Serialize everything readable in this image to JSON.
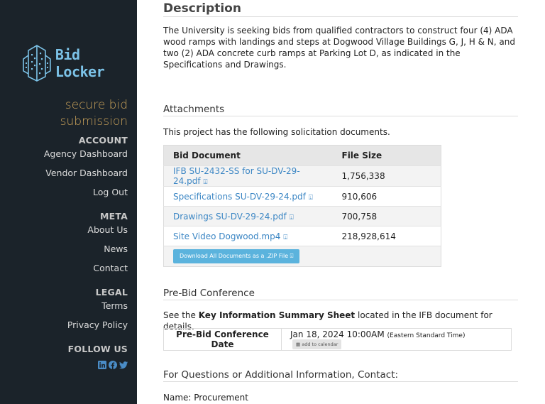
{
  "brand": {
    "name": "Bid Locker",
    "tagline_line1": "secure bid",
    "tagline_line2": "submission",
    "colors": {
      "sidebar_bg": "#1b232a",
      "logo": "#7cc3e8",
      "tagline": "#c9a25a",
      "link": "#3b86c4",
      "button": "#5bb3dd"
    }
  },
  "sidebar": {
    "account": {
      "heading": "ACCOUNT",
      "items": [
        "Agency Dashboard",
        "Vendor Dashboard",
        "Log Out"
      ]
    },
    "meta": {
      "heading": "META",
      "items": [
        "About Us",
        "News",
        "Contact"
      ]
    },
    "legal": {
      "heading": "LEGAL",
      "items": [
        "Terms",
        "Privacy Policy"
      ]
    },
    "follow": {
      "heading": "FOLLOW US",
      "icons": [
        "linkedin-icon",
        "facebook-icon",
        "twitter-icon"
      ]
    }
  },
  "description": {
    "title": "Description",
    "text": "The University is seeking bids from qualified contractors to construct four (4) ADA wood ramps with landings and steps at Dogwood Village Buildings G, J, H & N, and two (2) ADA concrete curb ramps at Parking Lot D, as indicated in the Specifications and Drawings."
  },
  "attachments": {
    "title": "Attachments",
    "intro": "This project has the following solicitation documents.",
    "columns": [
      "Bid Document",
      "File Size"
    ],
    "rows": [
      {
        "name": "IFB SU-2432-SS for SU-DV-29-24.pdf",
        "size": "1,756,338"
      },
      {
        "name": "Specifications SU-DV-29-24.pdf",
        "size": "910,606"
      },
      {
        "name": "Drawings SU-DV-29-24.pdf",
        "size": "700,758"
      },
      {
        "name": "Site Video Dogwood.mp4",
        "size": "218,928,614"
      }
    ],
    "download_all_label": "Download All Documents as a .ZIP File"
  },
  "pre_bid": {
    "title": "Pre-Bid Conference",
    "intro_prefix": "See the ",
    "intro_bold": "Key Information Summary Sheet",
    "intro_suffix": " located in the IFB document for details.",
    "date_label": "Pre-Bid Conference Date",
    "date_value": "Jan 18, 2024 10:00AM",
    "timezone": "(Eastern Standard Time)",
    "calendar_label": "add to calendar"
  },
  "contact": {
    "title": "For Questions or Additional Information, Contact:",
    "name_line": "Name: Procurement"
  }
}
